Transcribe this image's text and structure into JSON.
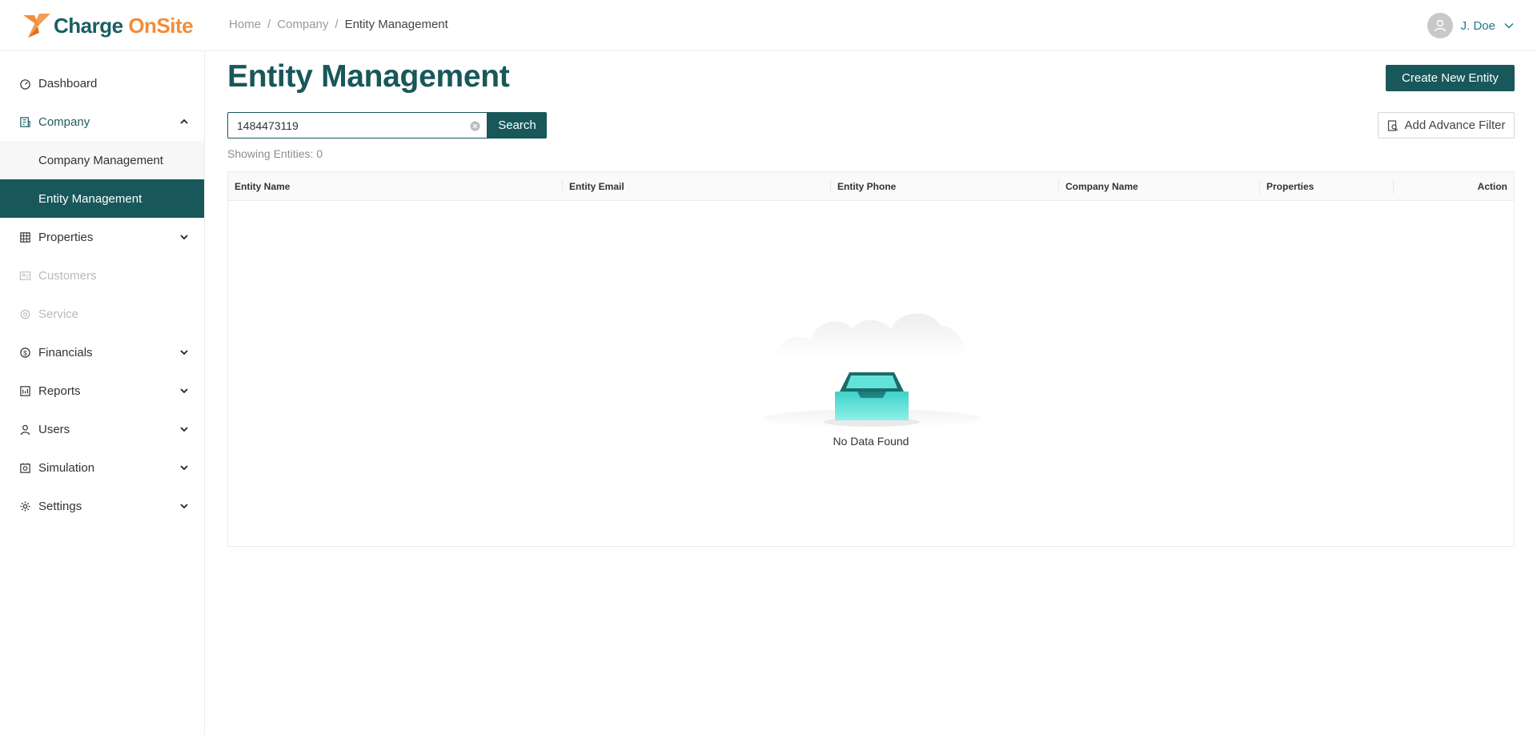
{
  "app": {
    "logo_part1": "Charge",
    "logo_part2": "OnSite",
    "brand_color": "#18575a",
    "accent_color": "#f28c38"
  },
  "breadcrumb": [
    "Home",
    "Company",
    "Entity Management"
  ],
  "user": {
    "name": "J. Doe"
  },
  "sidebar": {
    "items": [
      {
        "label": "Dashboard",
        "icon": "dashboard-icon"
      },
      {
        "label": "Company",
        "icon": "company-icon",
        "expanded": true
      },
      {
        "label": "Company Management",
        "sub": true
      },
      {
        "label": "Entity Management",
        "sub": true,
        "active": true
      },
      {
        "label": "Properties",
        "icon": "properties-icon"
      },
      {
        "label": "Customers",
        "icon": "customers-icon",
        "disabled": true
      },
      {
        "label": "Service",
        "icon": "service-icon",
        "disabled": true
      },
      {
        "label": "Financials",
        "icon": "financials-icon"
      },
      {
        "label": "Reports",
        "icon": "reports-icon"
      },
      {
        "label": "Users",
        "icon": "users-icon"
      },
      {
        "label": "Simulation",
        "icon": "simulation-icon"
      },
      {
        "label": "Settings",
        "icon": "settings-icon"
      }
    ]
  },
  "main": {
    "title": "Entity Management",
    "create_label": "Create New Entity",
    "search_value": "1484473119",
    "search_label": "Search",
    "filter_label": "Add Advance Filter",
    "showing_text": "Showing Entities: 0",
    "columns": [
      "Entity Name",
      "Entity Email",
      "Entity Phone",
      "Company Name",
      "Properties",
      "Action"
    ],
    "empty_text": "No Data Found"
  }
}
